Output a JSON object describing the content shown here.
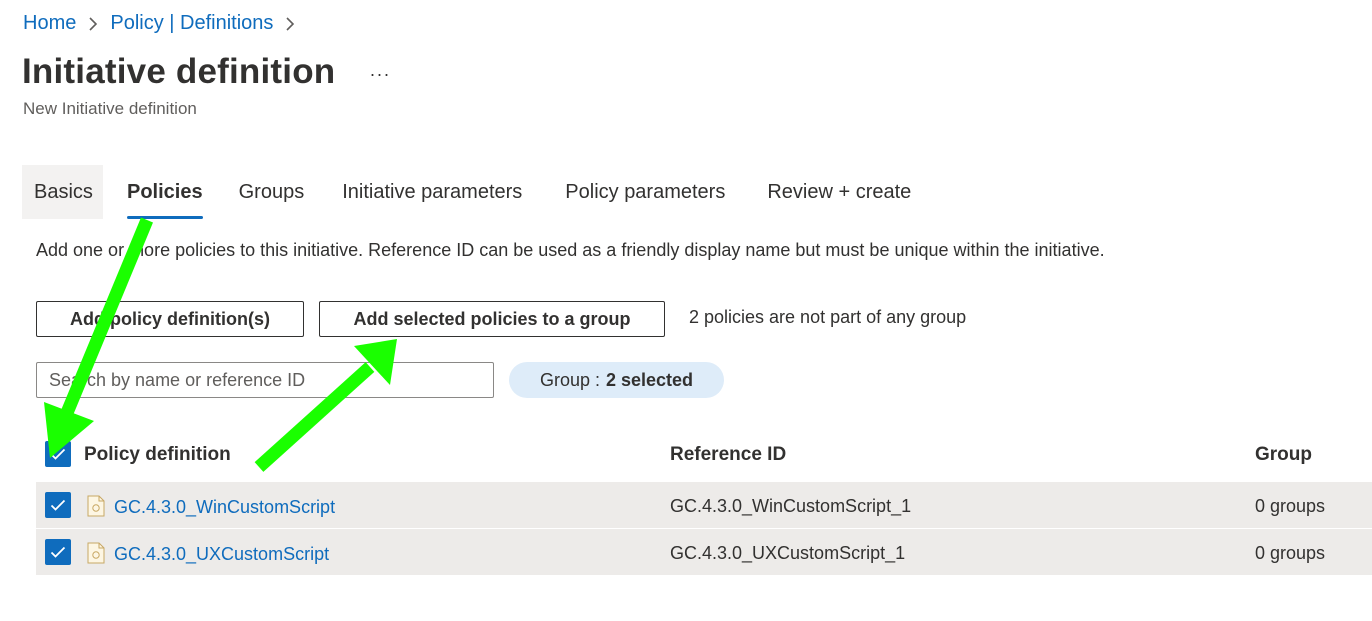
{
  "breadcrumb": {
    "home": "Home",
    "policy_defs": "Policy | Definitions"
  },
  "header": {
    "title": "Initiative definition",
    "more": "···",
    "subtitle": "New Initiative definition"
  },
  "tabs": [
    {
      "label": "Basics"
    },
    {
      "label": "Policies"
    },
    {
      "label": "Groups"
    },
    {
      "label": "Initiative parameters"
    },
    {
      "label": "Policy parameters"
    },
    {
      "label": "Review + create"
    }
  ],
  "policies_tab": {
    "description": "Add one or more policies to this initiative. Reference ID can be used as a friendly display name but must be unique within the initiative.",
    "add_definitions_label": "Add policy definition(s)",
    "add_to_group_label": "Add selected policies to a group",
    "group_note": "2 policies are not part of any group",
    "search_placeholder": "Search by name or reference ID",
    "filter_key": "Group :",
    "filter_value": "2 selected"
  },
  "table": {
    "headers": {
      "policy": "Policy definition",
      "reference": "Reference ID",
      "group": "Group"
    },
    "rows": [
      {
        "name": "GC.4.3.0_WinCustomScript",
        "reference_id": "GC.4.3.0_WinCustomScript_1",
        "group": "0 groups",
        "selected": true
      },
      {
        "name": "GC.4.3.0_UXCustomScript",
        "reference_id": "GC.4.3.0_UXCustomScript_1",
        "group": "0 groups",
        "selected": true
      }
    ]
  },
  "colors": {
    "accent": "#0f6cbd",
    "annotation_arrow": "#1aff00",
    "row_bg": "#edebe9",
    "pill_bg": "#deecf9"
  },
  "icons": {
    "breadcrumb_separator": "chevron-right-icon",
    "check": "checkmark-icon",
    "policy": "policy-document-icon",
    "annotation": "arrow-icon"
  }
}
